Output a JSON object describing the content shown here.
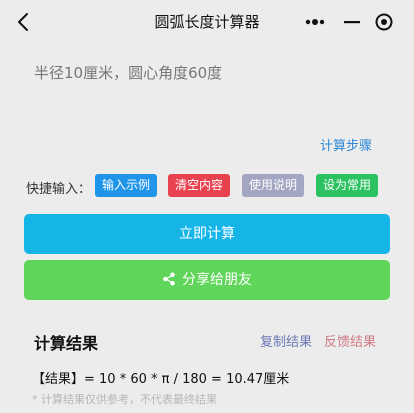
{
  "nav": {
    "title": "圆弧长度计算器"
  },
  "input": {
    "value": "半径10厘米，圆心角度60度"
  },
  "links": {
    "steps": "计算步骤"
  },
  "quick": {
    "label": "快捷输入：",
    "chips": [
      "输入示例",
      "清空内容",
      "使用说明",
      "设为常用"
    ]
  },
  "buttons": {
    "calculate": "立即计算",
    "share": "分享给朋友"
  },
  "result": {
    "title": "计算结果",
    "copy": "复制结果",
    "feedback": "反馈结果",
    "text": "【结果】= 10 * 60 * π / 180 = 10.47厘米",
    "disclaimer": "* 计算结果仅供参考，不代表最终结果"
  },
  "colors": {
    "background": "#ececec",
    "example": "#1e95e8",
    "clear": "#e8424f",
    "help": "#a3a6c2",
    "favorite": "#2cc261",
    "calculate": "#16b5e8",
    "share": "#5fd55a",
    "link": "#2d88d8"
  },
  "icons": {
    "back": "chevron-left-icon",
    "more": "more-dots-icon",
    "minimize": "minus-icon",
    "close": "target-circle-icon",
    "share": "share-icon"
  }
}
